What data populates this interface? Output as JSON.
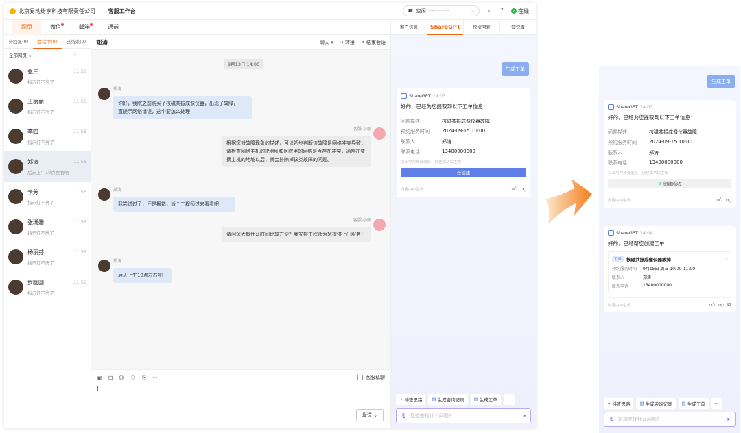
{
  "topbar": {
    "company": "北京易动纷享科技有限责任公司",
    "separator": "|",
    "workspace": "客服工作台",
    "phone_status": "空闲",
    "phone_number": "---·---·----",
    "online": "在线"
  },
  "nav": {
    "tabs": [
      "网页",
      "微信",
      "邮箱",
      "通话"
    ]
  },
  "list": {
    "subtabs": [
      "待回复(9)",
      "会话中(9)",
      "已结束(9)"
    ],
    "filter": "全部网页",
    "contacts": [
      {
        "name": "张三",
        "msg": "指示灯不亮了",
        "time": "11:56"
      },
      {
        "name": "王丽丽",
        "msg": "指示灯不亮了",
        "time": "11:56"
      },
      {
        "name": "李四",
        "msg": "指示灯不亮了",
        "time": "11:56"
      },
      {
        "name": "郑涛",
        "msg": "后天上午10点左右吧",
        "time": "11:56"
      },
      {
        "name": "李芳",
        "msg": "指示灯不亮了",
        "time": "11:56"
      },
      {
        "name": "张珊姗",
        "msg": "指示灯不亮了",
        "time": "11:56"
      },
      {
        "name": "杨丽芬",
        "msg": "指示灯不亮了",
        "time": "11:56"
      },
      {
        "name": "罗圆圆",
        "msg": "指示灯不亮了",
        "time": "11:56"
      }
    ]
  },
  "chat": {
    "title": "郑涛",
    "actions": [
      "聊天 ▾",
      "转接",
      "结束会话"
    ],
    "date": "9月13日 14:00",
    "messages": [
      {
        "from": "郑涛",
        "text": "你好，我院之前购买了核磁共振成像仪器，出现了故障，一直提示网络错误，这个要怎么处理"
      },
      {
        "from": "客服-小丽",
        "text": "根据您对故障现象的描述，可以初步判断该故障是网络冲突导致；请检查网络主机的IP地址和医院里的网络是否存在冲突，通常在变换主机的地址以后，就会排除掉该类故障的问题。"
      },
      {
        "from": "郑涛",
        "text": "我尝试过了，还是报错，派个工程师过来看看吧"
      },
      {
        "from": "客服-小丽",
        "text": "请问您大概什么时间比较方便？我安排工程师为您提供上门服务！"
      },
      {
        "from": "郑涛",
        "text": "后天上午10点左右吧"
      }
    ],
    "private_label": "客服私聊",
    "send_label": "发送",
    "cursor": "|"
  },
  "ai": {
    "tabs": [
      "客户信息",
      "ShareGPT",
      "快捷回复",
      "知识库"
    ],
    "user_cmd": "生成工单",
    "card1": {
      "bot": "ShareGPT",
      "time": "14:03",
      "intro": "好的，已经为您提取到以下工单信息：",
      "fields": [
        {
          "k": "问题描述",
          "v": "核磁共振成像仪器故障"
        },
        {
          "k": "预约服务时间",
          "v": "2024-09-15  10:00"
        },
        {
          "k": "联系人",
          "v": "郑涛"
        },
        {
          "k": "联系电话",
          "v": "13400000000"
        }
      ],
      "note": "以上均为预设信息，创建成功后生效",
      "create": "去创建",
      "created": "创建成功",
      "footer": "内容由AI生成"
    },
    "card2": {
      "bot": "ShareGPT",
      "time": "14:04",
      "intro": "好的，已经帮您创建工单：",
      "tag": "工单",
      "ticket_title": "核磁共振成像仪器故障",
      "fields": [
        {
          "k": "预约服务时间",
          "v": "9月15日 周五 10:00-11:00"
        },
        {
          "k": "联系人",
          "v": "郑涛"
        },
        {
          "k": "联系电话",
          "v": "13400000000"
        }
      ],
      "footer": "内容由AI生成"
    },
    "quick": [
      "排查思路",
      "生成咨询记录",
      "生成工单",
      "···"
    ],
    "ask_placeholder": "您想查找什么问题?"
  }
}
